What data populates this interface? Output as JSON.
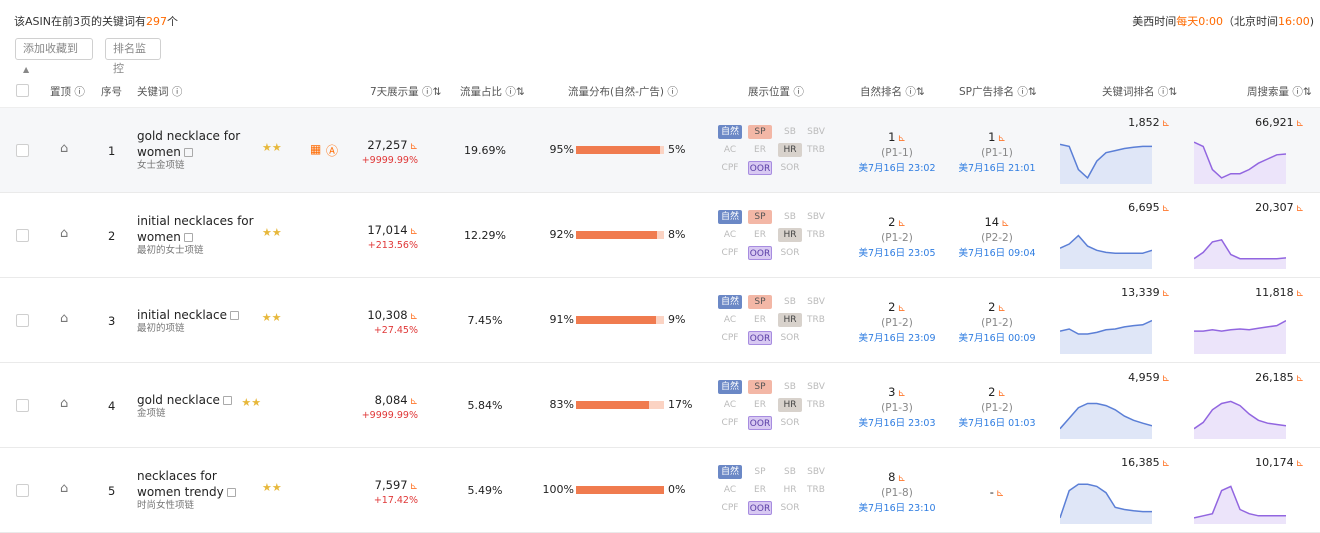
{
  "summary": {
    "prefix": "该ASIN在前3页的关键词有",
    "count": "297",
    "suffix": "个"
  },
  "timezone": {
    "prefix": "美西时间",
    "daily": "每天0:00",
    "mid": "（北京时间",
    "bj": "16:00",
    "suffix": ")"
  },
  "buttons": {
    "favorite": "添加收藏到",
    "monitor": "排名监控"
  },
  "headers": {
    "pin": "置顶",
    "index": "序号",
    "keyword": "关键词",
    "impressions": "7天展示量",
    "share": "流量占比",
    "distribution": "流量分布(自然-广告)",
    "position": "展示位置",
    "organic": "自然排名",
    "sp": "SP广告排名",
    "kwrank": "关键词排名",
    "weekly": "周搜索量"
  },
  "tag_labels": [
    "自然",
    "SP",
    "SB",
    "SBV",
    "AC",
    "ER",
    "HR",
    "TRB",
    "CPF",
    "OOR",
    "SOR"
  ],
  "rows": [
    {
      "index": "1",
      "kw": "gold necklace for women",
      "kw_cn": "女士金项链",
      "impr": "27,257",
      "chg": "+9999.99%",
      "share": "19.69%",
      "left": "95%",
      "right": "5%",
      "left_pct": 95,
      "active": [
        "自然",
        "SP",
        "HR",
        "OOR"
      ],
      "org_rank": "1",
      "org_page": "(P1-1)",
      "org_time": "美7月16日 23:02",
      "sp_rank": "1",
      "sp_page": "(P1-1)",
      "sp_time": "美7月16日 21:01",
      "kw_rank": "1,852",
      "weekly": "66,921"
    },
    {
      "index": "2",
      "kw": "initial necklaces for women",
      "kw_cn": "最初的女士项链",
      "impr": "17,014",
      "chg": "+213.56%",
      "share": "12.29%",
      "left": "92%",
      "right": "8%",
      "left_pct": 92,
      "active": [
        "自然",
        "SP",
        "HR",
        "OOR"
      ],
      "org_rank": "2",
      "org_page": "(P1-2)",
      "org_time": "美7月16日 23:05",
      "sp_rank": "14",
      "sp_page": "(P2-2)",
      "sp_time": "美7月16日 09:04",
      "kw_rank": "6,695",
      "weekly": "20,307"
    },
    {
      "index": "3",
      "kw": "initial necklace",
      "kw_cn": "最初的项链",
      "impr": "10,308",
      "chg": "+27.45%",
      "share": "7.45%",
      "left": "91%",
      "right": "9%",
      "left_pct": 91,
      "active": [
        "自然",
        "SP",
        "HR",
        "OOR"
      ],
      "org_rank": "2",
      "org_page": "(P1-2)",
      "org_time": "美7月16日 23:09",
      "sp_rank": "2",
      "sp_page": "(P1-2)",
      "sp_time": "美7月16日 00:09",
      "kw_rank": "13,339",
      "weekly": "11,818"
    },
    {
      "index": "4",
      "kw": "gold necklace",
      "kw_cn": "金项链",
      "impr": "8,084",
      "chg": "+9999.99%",
      "share": "5.84%",
      "left": "83%",
      "right": "17%",
      "left_pct": 83,
      "active": [
        "自然",
        "SP",
        "HR",
        "OOR"
      ],
      "org_rank": "3",
      "org_page": "(P1-3)",
      "org_time": "美7月16日 23:03",
      "sp_rank": "2",
      "sp_page": "(P1-2)",
      "sp_time": "美7月16日 01:03",
      "kw_rank": "4,959",
      "weekly": "26,185"
    },
    {
      "index": "5",
      "kw": "necklaces for women trendy",
      "kw_cn": "时尚女性项链",
      "impr": "7,597",
      "chg": "+17.42%",
      "share": "5.49%",
      "left": "100%",
      "right": "0%",
      "left_pct": 100,
      "active": [
        "自然",
        "OOR"
      ],
      "org_rank": "8",
      "org_page": "(P1-8)",
      "org_time": "美7月16日 23:10",
      "sp_rank": "-",
      "sp_page": "",
      "sp_time": "",
      "kw_rank": "16,385",
      "weekly": "10,174"
    }
  ],
  "colors": {
    "accent": "#ff6a00",
    "bar_fill": "#f07b4f",
    "bar_bg": "#fbd3c3",
    "rank_line": "#5b7fd6",
    "weekly_line": "#9266e0",
    "time_blue": "#2f7de1"
  }
}
